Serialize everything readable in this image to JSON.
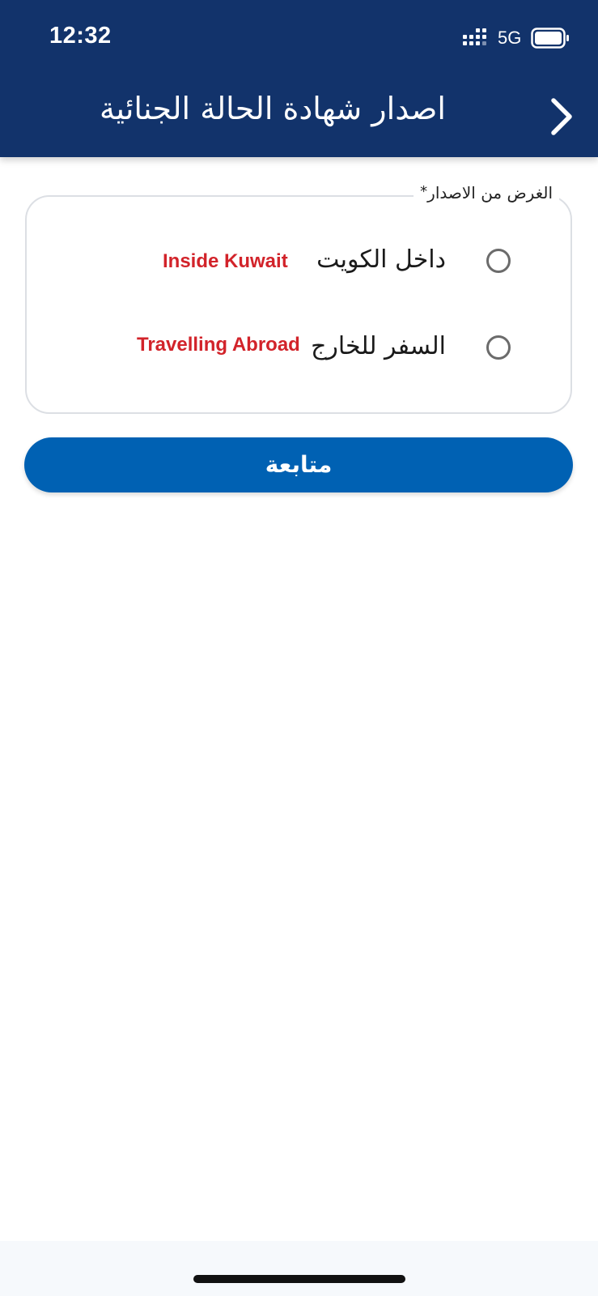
{
  "status_bar": {
    "time": "12:32",
    "network": "5G",
    "icons": [
      "signal-icon",
      "battery-icon"
    ]
  },
  "header": {
    "title": "اصدار شهادة الحالة الجنائية",
    "back_icon": "chevron-right-icon"
  },
  "purpose": {
    "label": "الغرض من الاصدار",
    "required_mark": "*",
    "options": [
      {
        "label": "داخل الكويت",
        "annotation": "Inside Kuwait",
        "selected": false
      },
      {
        "label": "السفر للخارج",
        "annotation": "Travelling Abroad",
        "selected": false
      }
    ]
  },
  "actions": {
    "continue_label": "متابعة"
  },
  "colors": {
    "header_bg": "#12336b",
    "primary_button": "#0061b3",
    "annotation": "#d2232a"
  }
}
